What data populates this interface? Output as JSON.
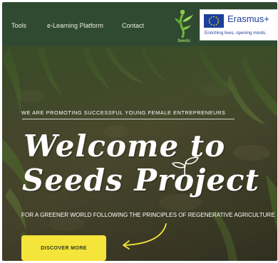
{
  "nav": {
    "items": [
      {
        "label": "Tools"
      },
      {
        "label": "e-Learning Platform"
      },
      {
        "label": "Contact"
      }
    ]
  },
  "logo": {
    "name": "Seeds",
    "icon": "seedling-person-logo"
  },
  "erasmus": {
    "name": "Erasmus+",
    "tagline": "Enriching lives, opening minds."
  },
  "hero": {
    "eyebrow": "WE ARE PROMOTING SUCCESSFUL YOUNG FEMALE ENTREPRENEURS",
    "title_line1": "Welcome to",
    "title_line2": "Seeds Project",
    "subtitle": "FOR A GREENER WORLD FOLLOWING THE PRINCIPLES OF REGENERATIVE AGRICULTURE",
    "cta_label": "DISCOVER MORE"
  },
  "colors": {
    "header_bg": "#2f4a30",
    "accent_green": "#9bd25e",
    "cta_yellow": "#f5e43a",
    "erasmus_blue": "#21409a"
  }
}
